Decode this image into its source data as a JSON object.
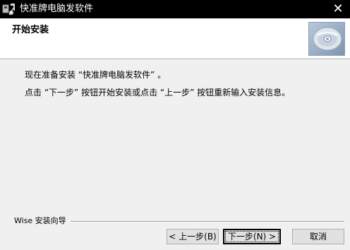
{
  "window": {
    "title": "快准牌电脑发软件",
    "close_glyph": "✕",
    "app_icon": "installer-app-icon"
  },
  "header": {
    "title": "开始安装",
    "image": "cd-disc-icon"
  },
  "content": {
    "line1": "现在准备安装 “快准牌电脑发软件” 。",
    "line2": "点击 “下一步” 按钮开始安装或点击 “上一步” 按钮重新输入安装信息。"
  },
  "footer": {
    "group_label": "Wise 安装向导"
  },
  "buttons": {
    "back": "< 上一步(B)",
    "next": "下一步(N) >",
    "cancel": "取消"
  },
  "colors": {
    "titlebar": "#000000",
    "header_bg": "#ffffff",
    "dialog_bg": "#f0f0f0"
  }
}
